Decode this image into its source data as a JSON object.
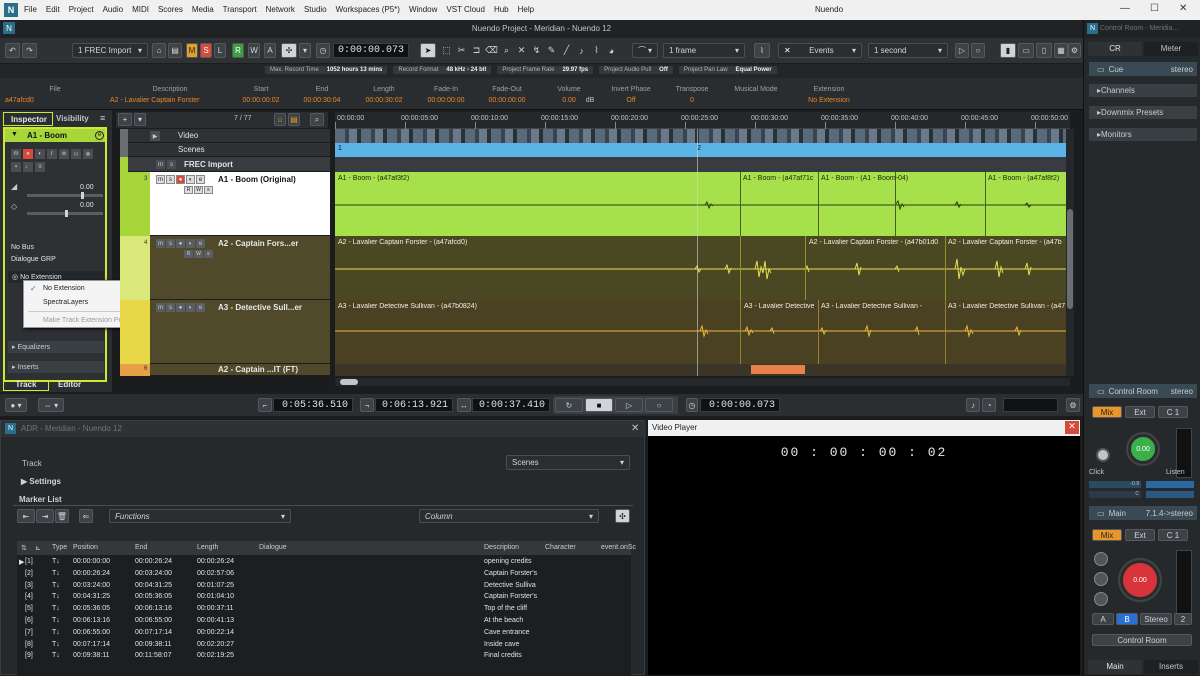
{
  "menubar": {
    "items": [
      "File",
      "Edit",
      "Project",
      "Audio",
      "MIDI",
      "Scores",
      "Media",
      "Transport",
      "Network",
      "Studio",
      "Workspaces (P5*)",
      "Window",
      "VST Cloud",
      "Hub",
      "Help"
    ],
    "app_title": "Nuendo"
  },
  "titlebar": {
    "title": "Nuendo Project - Meridian - Nuendo 12"
  },
  "toolbar": {
    "track_name": "1 FREC Import",
    "msrwa": [
      "M",
      "S",
      "L",
      "R",
      "W",
      "A"
    ],
    "timecode": "0:00:00.073",
    "grid_value": "1 frame",
    "events_label": "Events",
    "quantize_value": "1 second"
  },
  "statusbar": [
    {
      "label": "Max. Record Time",
      "value": "1052 hours 13 mins"
    },
    {
      "label": "Record Format",
      "value": "48 kHz - 24 bit"
    },
    {
      "label": "Project Frame Rate",
      "value": "29.97 fps"
    },
    {
      "label": "Project Audio Pull",
      "value": "Off"
    },
    {
      "label": "Project Pan Law",
      "value": "Equal Power"
    }
  ],
  "infoline": {
    "columns": [
      {
        "label": "File",
        "value": "a47afcd0"
      },
      {
        "label": "Description",
        "value": "A2 - Lavalier Captain Forster"
      },
      {
        "label": "Start",
        "value": "00:00:00:02"
      },
      {
        "label": "End",
        "value": "00:00:30:04"
      },
      {
        "label": "Length",
        "value": "00:00:30:02"
      },
      {
        "label": "Fade-In",
        "value": "00:00:00:00"
      },
      {
        "label": "Fade-Out",
        "value": "00:00:00:00"
      },
      {
        "label": "Volume",
        "value": "0.00"
      },
      {
        "label": "Volume unit",
        "value": "dB"
      },
      {
        "label": "Invert Phase",
        "value": "Off"
      },
      {
        "label": "Transpose",
        "value": "0"
      },
      {
        "label": "Musical Mode",
        "value": ""
      },
      {
        "label": "Extension",
        "value": "No Extension"
      }
    ]
  },
  "inspector": {
    "tabs": [
      "Inspector",
      "Visibility"
    ],
    "track_name": "A1 - Boom",
    "fader_val1": "0.00",
    "fader_val2": "0.00",
    "routing_out": "No Bus",
    "routing_group": "Dialogue GRP",
    "extension": "No Extension",
    "sections": [
      "Equalizers",
      "Inserts"
    ],
    "bottom_tabs": [
      "Track",
      "Editor"
    ]
  },
  "context_menu": {
    "items": [
      "No Extension",
      "SpectraLayers",
      "Make Track Extension Permanent"
    ]
  },
  "project": {
    "track_counter": "7 / 77",
    "ruler": [
      "00:00:00",
      "00:00:05:00",
      "00:00:10:00",
      "00:00:15:00",
      "00:00:20:00",
      "00:00:25:00",
      "00:00:30:00",
      "00:00:35:00",
      "00:00:40:00",
      "00:00:45:00",
      "00:00:50:00"
    ],
    "tracks": [
      {
        "name": "Video"
      },
      {
        "name": "Scenes"
      },
      {
        "name": "FREC Import"
      },
      {
        "num": "3",
        "name": "A1 - Boom  (Original)"
      },
      {
        "num": "4",
        "name": "A2 - Captain Fors...er"
      },
      {
        "num": "5",
        "name": "A3 - Detective Sull...er"
      },
      {
        "num": "6",
        "name": "A2 - Captain ...lT (FT)"
      }
    ],
    "clips_a1": [
      "A1 - Boom - (a47af3f2)",
      "A1 - Boom - (a47af71c",
      "A1 - Boom - (A1 - Boom-04)",
      "A1 - Boom - (a47af8f2)"
    ],
    "clips_a2": [
      "A2 - Lavalier Captain Forster - (a47afcd0)",
      "A2 - Lavalier Captain Forster - (a47b01d0",
      "A2 - Lavalier Captain Forster - (a47b"
    ],
    "clips_a3": [
      "A3 - Lavalier Detective Sullivan - (a47b0824)",
      "A3 - Lavalier Detective",
      "A3 - Lavalier Detective Sullivan -",
      "A3 - Lavalier Detective Sullivan - (a47"
    ],
    "scene_markers": [
      "1",
      "2"
    ]
  },
  "transport": {
    "left_locator": "0:05:36.510",
    "right_locator": "0:06:13.921",
    "length": "0:00:37.410",
    "position": "0:00:00.073"
  },
  "adr": {
    "title": "ADR - Meridian - Nuendo 12",
    "track_label": "Track",
    "track_value": "Scenes",
    "settings_label": "Settings",
    "marker_list_label": "Marker List",
    "functions_placeholder": "Functions",
    "column_placeholder": "Column",
    "headers": [
      "Type",
      "Position",
      "End",
      "Length",
      "Dialogue",
      "Description",
      "Character",
      "event.onSc"
    ],
    "rows": [
      {
        "id": "[1]",
        "pos": "00:00:00:00",
        "end": "00:00:26:24",
        "len": "00:00:26:24",
        "desc": "opening credits"
      },
      {
        "id": "[2]",
        "pos": "00:00:26:24",
        "end": "00:03:24:00",
        "len": "00:02:57:06",
        "desc": "Captain Forster's"
      },
      {
        "id": "[3]",
        "pos": "00:03:24:00",
        "end": "00:04:31:25",
        "len": "00:01:07:25",
        "desc": "Detective Sulliva"
      },
      {
        "id": "[4]",
        "pos": "00:04:31:25",
        "end": "00:05:36:05",
        "len": "00:01:04:10",
        "desc": "Captain Forster's"
      },
      {
        "id": "[5]",
        "pos": "00:05:36:05",
        "end": "00:06:13:16",
        "len": "00:00:37:11",
        "desc": "Top of the cliff"
      },
      {
        "id": "[6]",
        "pos": "00:06:13:16",
        "end": "00:06:55:00",
        "len": "00:00:41:13",
        "desc": "At the beach"
      },
      {
        "id": "[7]",
        "pos": "00:06:55:00",
        "end": "00:07:17:14",
        "len": "00:00:22:14",
        "desc": "Cave entrance"
      },
      {
        "id": "[8]",
        "pos": "00:07:17:14",
        "end": "00:09:38:11",
        "len": "00:02:20:27",
        "desc": "Inside cave"
      },
      {
        "id": "[9]",
        "pos": "00:09:38:11",
        "end": "00:11:58:07",
        "len": "00:02:19:25",
        "desc": "Final credits"
      }
    ]
  },
  "video": {
    "title": "Video Player",
    "timecode": "00 : 00 : 00 : 02"
  },
  "control_room": {
    "title": "Control Room - Meridia...",
    "tabs": [
      "CR",
      "Meter"
    ],
    "cue_label": "Cue",
    "cue_value": "stereo",
    "sections": [
      "Channels",
      "Downmix Presets",
      "Monitors"
    ],
    "cr_label": "Control Room",
    "cr_value": "stereo",
    "src_buttons": [
      "Mix",
      "Ext",
      "C 1"
    ],
    "click_label": "Click",
    "listen_label": "Listen",
    "knob_value": "0.00",
    "click_meter": "-0.9",
    "click_c": "C",
    "main_label": "Main",
    "main_value": "7.1.4->stereo",
    "main_buttons": [
      "Mix",
      "Ext",
      "C 1"
    ],
    "main_knob_value": "0.00",
    "abs_buttons": [
      "A",
      "B",
      "Stereo",
      "2"
    ],
    "cr_button": "Control Room",
    "bottom_tabs": [
      "Main",
      "Inserts"
    ]
  }
}
